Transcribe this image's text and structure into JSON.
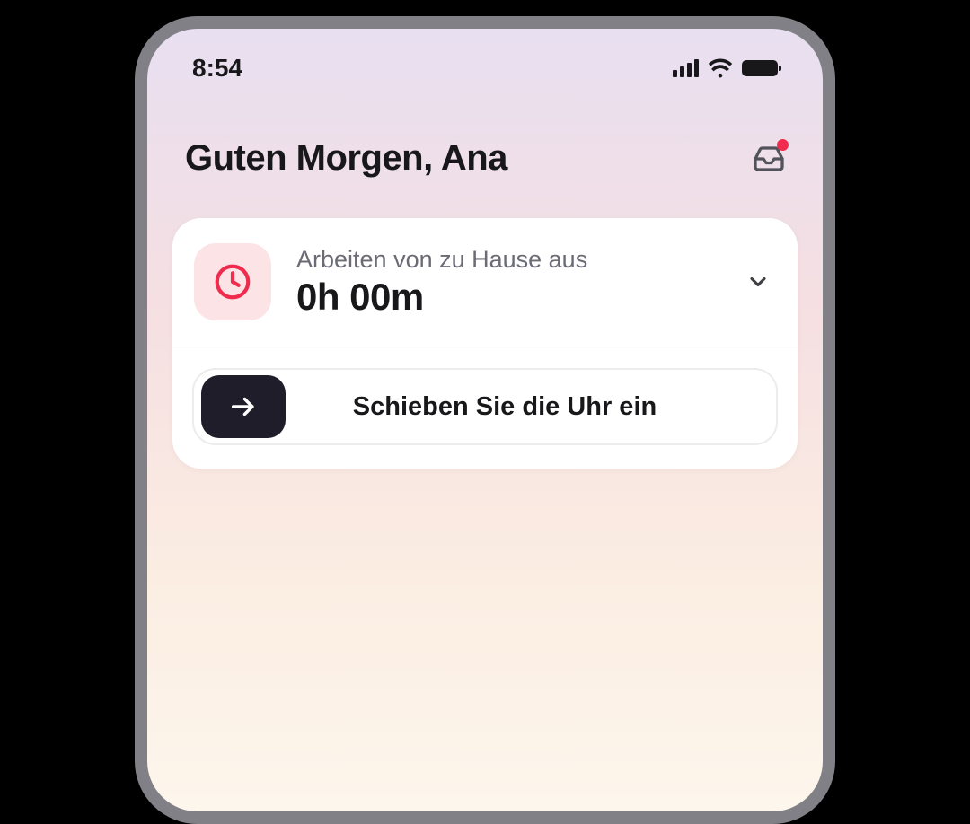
{
  "status_bar": {
    "time": "8:54"
  },
  "header": {
    "greeting": "Guten Morgen, Ana"
  },
  "work_status": {
    "label": "Arbeiten von zu Hause aus",
    "elapsed": "0h 00m"
  },
  "clock_in": {
    "slide_label": "Schieben Sie die Uhr ein"
  },
  "colors": {
    "accent_red": "#ef2c4d",
    "clock_icon_bg": "#fce4e6",
    "slide_handle_bg": "#1e1d29"
  }
}
